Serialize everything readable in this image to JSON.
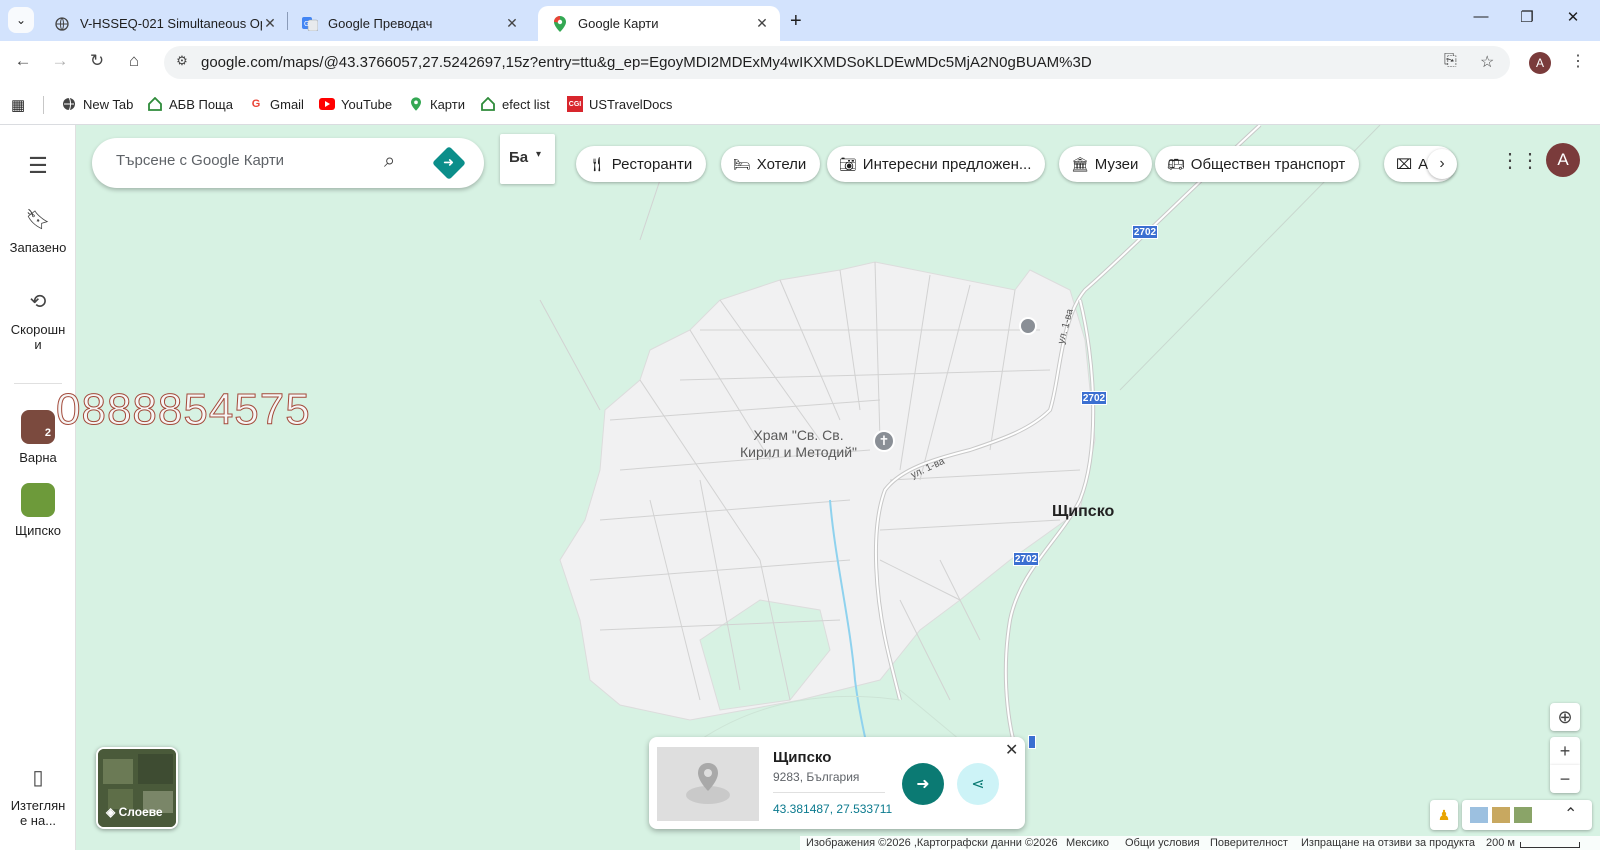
{
  "tabs": [
    {
      "title": "V-HSSEQ-021 Simultaneous Op",
      "favicon": "globe-icon"
    },
    {
      "title": "Google Преводач",
      "favicon": "google-translate-icon"
    },
    {
      "title": "Google Карти",
      "favicon": "google-maps-icon",
      "active": true
    }
  ],
  "address_bar": {
    "url": "google.com/maps/@43.3766057,27.5242697,15z?entry=ttu&g_ep=EgoyMDI2MDExMy4wIKXMDSoKLDEwMDc5MjA2N0gBUAM%3D"
  },
  "profile": {
    "initial": "A"
  },
  "bookmarks": [
    {
      "label": "New Tab",
      "icon": "globe-icon"
    },
    {
      "label": "АБВ Поща",
      "icon": "abv-house-icon"
    },
    {
      "label": "Gmail",
      "icon": "google-g-icon"
    },
    {
      "label": "YouTube",
      "icon": "youtube-icon"
    },
    {
      "label": "Карти",
      "icon": "maps-pin-icon"
    },
    {
      "label": "efect list",
      "icon": "house-icon"
    },
    {
      "label": "USTravelDocs",
      "icon": "cgi-icon"
    }
  ],
  "rail": {
    "saved": "Запазено",
    "recent_line1": "Скорошн",
    "recent_line2": "и",
    "varna": "Варна",
    "varna_badge": "2",
    "shtipsko": "Щипско",
    "download_line1": "Изтеглян",
    "download_line2": "е на..."
  },
  "search": {
    "placeholder": "Търсене с Google Карти"
  },
  "language_toggle": {
    "label": "Ба"
  },
  "chips": [
    {
      "label": "Ресторанти",
      "icon": "fork-knife-icon"
    },
    {
      "label": "Хотели",
      "icon": "bed-icon"
    },
    {
      "label": "Интересни предложен...",
      "icon": "camera-icon"
    },
    {
      "label": "Музеи",
      "icon": "museum-icon"
    },
    {
      "label": "Обществен транспорт",
      "icon": "bus-icon"
    },
    {
      "label": "А",
      "icon": "pharmacy-icon"
    }
  ],
  "overlay_phone": "0888854575",
  "map": {
    "church_line1": "Храм \"Св. Св.",
    "church_line2": "Кирил и Методий\"",
    "village": "Щипско",
    "road_label": "ул. 1-ва",
    "road_number": "2702"
  },
  "layers": {
    "label": "Слоеве"
  },
  "place_card": {
    "name": "Щипско",
    "address": "9283, България",
    "coords": "43.381487, 27.533711"
  },
  "footer": {
    "attribution": "Изображения ©2026 ,Картографски данни ©2026",
    "country": "Мексико",
    "terms": "Общи условия",
    "privacy": "Поверителност",
    "feedback": "Изпращане на отзиви за продукта",
    "scale": "200 м"
  }
}
